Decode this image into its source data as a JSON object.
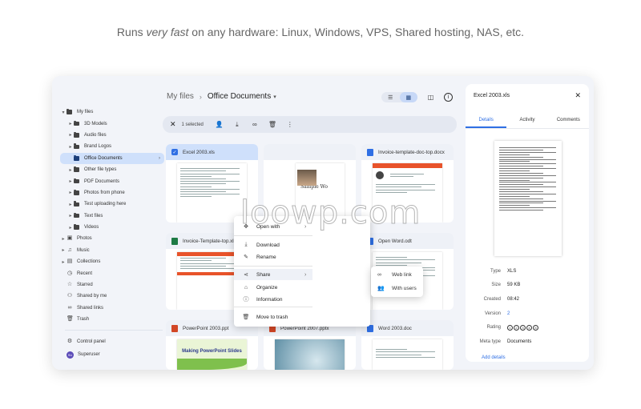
{
  "tagline": {
    "pre": "Runs ",
    "em": "very fast",
    "post": " on any hardware: Linux, Windows, VPS, Shared hosting, NAS, etc."
  },
  "sidebar": {
    "items": [
      {
        "label": "My files",
        "level": 0,
        "chev": "▾"
      },
      {
        "label": "3D Models",
        "level": 1,
        "chev": "▸"
      },
      {
        "label": "Audio files",
        "level": 1,
        "chev": "▸"
      },
      {
        "label": "Brand Logos",
        "level": 1,
        "chev": "▸"
      },
      {
        "label": "Office Documents",
        "level": 1,
        "chev": "",
        "active": true
      },
      {
        "label": "Other file types",
        "level": 1,
        "chev": "▸"
      },
      {
        "label": "PDF Documents",
        "level": 1,
        "chev": "▸"
      },
      {
        "label": "Photos from phone",
        "level": 1,
        "chev": "▸"
      },
      {
        "label": "Test uploading here",
        "level": 1,
        "chev": "▸"
      },
      {
        "label": "Text files",
        "level": 1,
        "chev": "▸"
      },
      {
        "label": "Videos",
        "level": 1,
        "chev": "▸"
      }
    ],
    "groups": [
      {
        "label": "Photos",
        "icon": "▣"
      },
      {
        "label": "Music",
        "icon": "♫"
      },
      {
        "label": "Collections",
        "icon": "▤"
      },
      {
        "label": "Recent",
        "icon": "◷"
      },
      {
        "label": "Starred",
        "icon": "☆"
      },
      {
        "label": "Shared by me",
        "icon": "⚇"
      },
      {
        "label": "Shared links",
        "icon": "∞"
      },
      {
        "label": "Trash",
        "icon": "🗑"
      }
    ],
    "control_panel": "Control panel",
    "user": "Superuser",
    "user_initials": "SU"
  },
  "header": {
    "root": "My files",
    "current": "Office Documents"
  },
  "selection": {
    "count_label": "1 selected"
  },
  "files": [
    {
      "name": "Excel 2003.xls",
      "color": "#1e7b45"
    },
    {
      "name": "Invoice-template-doc-top.docx",
      "color": "#2f6fe4"
    },
    {
      "name": "Invoice-Template-top.xlsx",
      "color": "#1e7b45"
    },
    {
      "name": "Open Word.odt",
      "color": "#2f6fe4"
    },
    {
      "name": "PowerPoint 2003.ppt",
      "color": "#d24726"
    },
    {
      "name": "PowerPoint 2007.pptx",
      "color": "#d24726"
    },
    {
      "name": "Word 2003.doc",
      "color": "#2f6fe4"
    }
  ],
  "thumb_text": {
    "sample": "Sample Wo",
    "ppt_slide": "Making PowerPoint Slides"
  },
  "context_menu": {
    "open_with": "Open with",
    "download": "Download",
    "rename": "Rename",
    "share": "Share",
    "organize": "Organize",
    "information": "Information",
    "move_to_trash": "Move to trash"
  },
  "share_submenu": {
    "web_link": "Web link",
    "with_users": "With users"
  },
  "details": {
    "title": "Excel 2003.xls",
    "tabs": [
      "Details",
      "Activity",
      "Comments"
    ],
    "props": [
      {
        "k": "Type",
        "v": "XLS"
      },
      {
        "k": "Size",
        "v": "59 KB"
      },
      {
        "k": "Created",
        "v": "08:42"
      },
      {
        "k": "Version",
        "v": "2"
      },
      {
        "k": "Rating",
        "v": ""
      },
      {
        "k": "Meta type",
        "v": "Documents"
      }
    ],
    "add_details": "Add details"
  },
  "watermark": "loowp.com"
}
